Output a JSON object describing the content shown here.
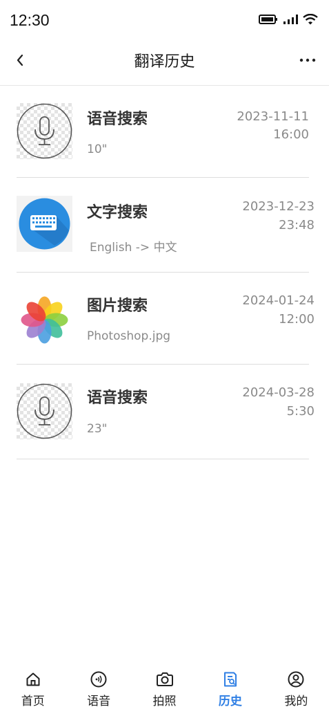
{
  "status_bar": {
    "time": "12:30",
    "icons": [
      "battery-icon",
      "signal-icon",
      "wifi-icon"
    ]
  },
  "nav": {
    "title": "翻译历史",
    "back_icon": "chevron-left-icon",
    "more_icon": "more-horizontal-icon"
  },
  "history": [
    {
      "type": "voice",
      "icon": "microphone-icon",
      "title": "语音搜索",
      "subtitle": "10\"",
      "date": "2023-11-11",
      "time": "16:00"
    },
    {
      "type": "text",
      "icon": "keyboard-icon",
      "title": "文字搜索",
      "subtitle": "English -> 中文",
      "date": "2023-12-23",
      "time": "23:48"
    },
    {
      "type": "image",
      "icon": "photos-icon",
      "title": "图片搜索",
      "subtitle": "Photoshop.jpg",
      "date": "2024-01-24",
      "time": "12:00"
    },
    {
      "type": "voice",
      "icon": "microphone-icon",
      "title": "语音搜索",
      "subtitle": "23\"",
      "date": "2024-03-28",
      "time": "5:30"
    }
  ],
  "tabs": [
    {
      "label": "首页",
      "icon": "home-icon",
      "active": false
    },
    {
      "label": "语音",
      "icon": "voice-icon",
      "active": false
    },
    {
      "label": "拍照",
      "icon": "camera-icon",
      "active": false
    },
    {
      "label": "历史",
      "icon": "history-icon",
      "active": true
    },
    {
      "label": "我的",
      "icon": "profile-icon",
      "active": false
    }
  ],
  "colors": {
    "accent": "#2f7fe4",
    "keyboard_bg": "#2a8de0",
    "text_secondary": "#8a8a8a",
    "divider": "#dddddd"
  }
}
